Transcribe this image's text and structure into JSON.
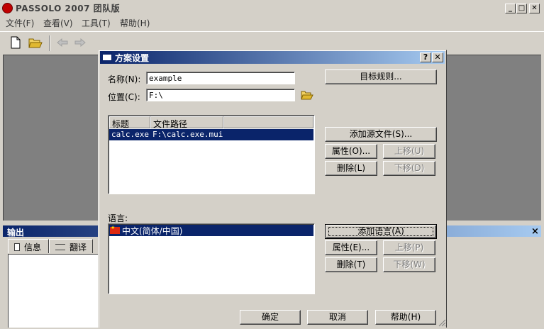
{
  "app": {
    "title": "PASSOLO 2007 团队版",
    "min_glyph": "_",
    "max_glyph": "□",
    "close_glyph": "✕"
  },
  "menu": [
    "文件(F)",
    "查看(V)",
    "工具(T)",
    "帮助(H)"
  ],
  "output": {
    "title": "输出",
    "close_glyph": "×",
    "tabs": [
      "信息",
      "翻译"
    ]
  },
  "dialog": {
    "title": "方案设置",
    "help_glyph": "?",
    "close_glyph": "✕",
    "name_label": "名称(N):",
    "name_value": "example",
    "location_label": "位置(C):",
    "location_value": "F:\\",
    "target_rules_button": "目标规则...",
    "source_list": {
      "columns": [
        "标题",
        "文件路径"
      ],
      "rows": [
        {
          "title": "calc.exe",
          "path": "F:\\calc.exe.mui"
        }
      ]
    },
    "add_source_button": "添加源文件(S)...",
    "source_properties_button": "属性(O)...",
    "source_move_up_button": "上移(U)",
    "source_delete_button": "删除(L)",
    "source_move_down_button": "下移(D)",
    "language_label": "语言:",
    "languages": [
      "中文(简体/中国)"
    ],
    "add_language_button": "添加语言(A)",
    "language_properties_button": "属性(E)...",
    "language_move_up_button": "上移(P)",
    "language_delete_button": "删除(T)",
    "language_move_down_button": "下移(W)",
    "ok_button": "确定",
    "cancel_button": "取消",
    "help_button": "帮助(H)"
  }
}
